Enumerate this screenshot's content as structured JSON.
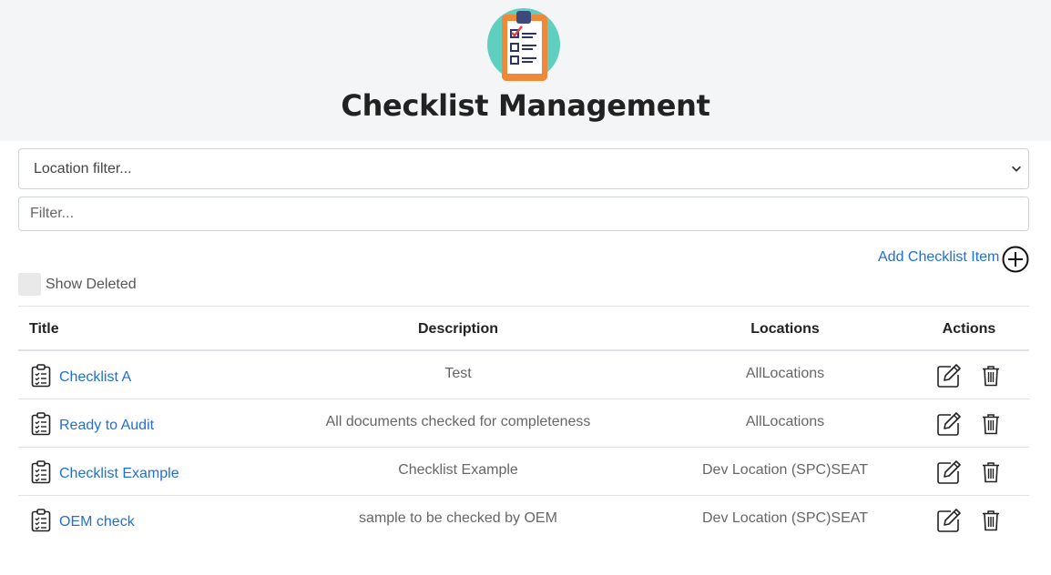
{
  "header": {
    "title": "Checklist Management",
    "logo_icon": "clipboard-checklist-logo"
  },
  "filters": {
    "location_select_value": "Location filter...",
    "filter_placeholder": "Filter..."
  },
  "actions": {
    "add_label": "Add Checklist Item",
    "add_icon": "plus-circle-icon"
  },
  "show_deleted": {
    "label": "Show Deleted",
    "checked": false
  },
  "table": {
    "headers": {
      "title": "Title",
      "description": "Description",
      "locations": "Locations",
      "actions": "Actions"
    },
    "rows": [
      {
        "title": "Checklist A",
        "description": "Test",
        "locations": "AllLocations"
      },
      {
        "title": "Ready to Audit",
        "description": "All documents checked for completeness",
        "locations": "AllLocations"
      },
      {
        "title": "Checklist Example",
        "description": "Checklist Example",
        "locations": "Dev Location (SPC)SEAT"
      },
      {
        "title": "OEM check",
        "description": "sample to be checked by OEM",
        "locations": "Dev Location (SPC)SEAT"
      }
    ]
  },
  "colors": {
    "link": "#1f6fd6",
    "header_bg": "#f4f5f6",
    "logo_circle": "#5fcfbf",
    "logo_board": "#f0883a"
  }
}
